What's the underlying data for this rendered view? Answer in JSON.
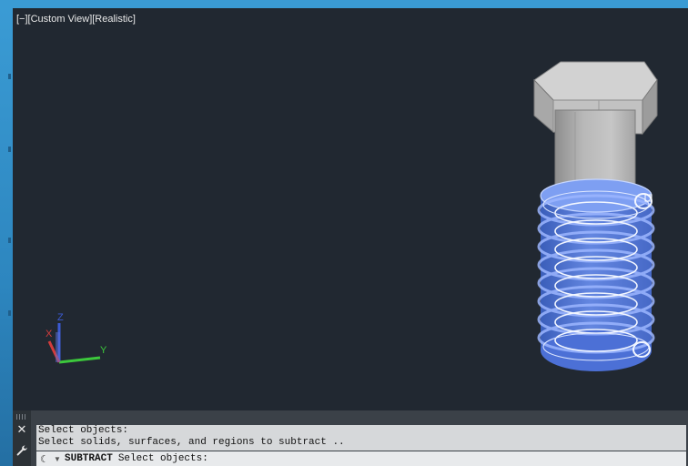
{
  "viewport": {
    "view_controls": "[−][Custom View][Realistic]",
    "ucs": {
      "x_label": "X",
      "y_label": "Y",
      "z_label": "Z"
    }
  },
  "command_line": {
    "close_glyph": "✕",
    "history": [
      "Select objects:",
      "Select solids, surfaces, and regions to subtract .."
    ],
    "current_command": "SUBTRACT",
    "current_prompt": "Select objects:"
  },
  "colors": {
    "viewport_bg": "#212831",
    "frame_blue": "#2a8fc8",
    "selection_blue": "#4f7ee8",
    "ucs_x": "#d23c3c",
    "ucs_y": "#3cc83c",
    "ucs_z": "#3c5ad2"
  }
}
